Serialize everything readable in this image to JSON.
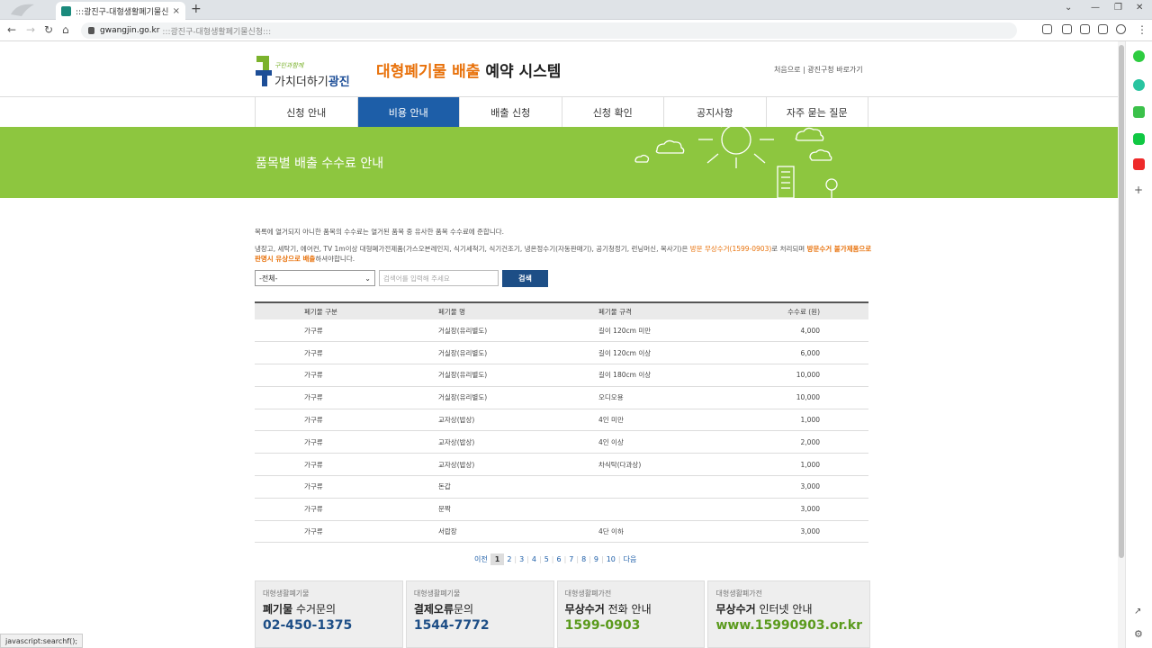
{
  "browser": {
    "tab_title": ":::광진구-대형생활폐기물신청:::",
    "close": "×",
    "new_tab": "+",
    "url_host": "gwangjin.go.kr",
    "url_path": ":::광진구-대형생활폐기물신청:::",
    "status_text": "javascript:searchf();"
  },
  "header": {
    "slogan": "구민과함께",
    "logo_text": "가치더하기",
    "logo_bold": "광진",
    "title_orange": "대형폐기물 배출",
    "title_rest": "예약 시스템",
    "links": "처음으로 | 광진구청 바로가기"
  },
  "nav": [
    {
      "label": "신청 안내",
      "active": false
    },
    {
      "label": "비용 안내",
      "active": true
    },
    {
      "label": "배출 신청",
      "active": false
    },
    {
      "label": "신청 확인",
      "active": false
    },
    {
      "label": "공지사항",
      "active": false
    },
    {
      "label": "자주 묻는 질문",
      "active": false
    }
  ],
  "banner": {
    "title": "품목별 배출 수수료 안내"
  },
  "notice": {
    "line1": "목록에 열거되지 아니한 품목의 수수료는 열거된 품목 중 유사한 품목 수수료에 준합니다.",
    "line2_a": "냉장고, 세탁기, 에어컨, TV 1m이상 대형폐가전제품(가스오븐레인지, 식기세척기, 식기건조기, 냉온정수기(자동판매기), 공기청정기, 런닝머신, 복사기)은",
    "line2_b": "방문 무상수거(1599-0903)",
    "line2_c": "로 처리되며",
    "line2_d": "방문수거 불가제품으로 판명시 유상으로 배출",
    "line2_e": "하셔야합니다."
  },
  "filter": {
    "select_value": "-전체-",
    "search_placeholder": "검색어를 입력해 주세요",
    "search_button": "검색"
  },
  "table": {
    "headers": [
      "폐기물 구분",
      "폐기물 명",
      "폐기물 규격",
      "수수료 (원)"
    ],
    "rows": [
      [
        "가구류",
        "거실장(유리별도)",
        "길이 120cm 미만",
        "4,000"
      ],
      [
        "가구류",
        "거실장(유리별도)",
        "길이 120cm 이상",
        "6,000"
      ],
      [
        "가구류",
        "거실장(유리별도)",
        "길이 180cm 이상",
        "10,000"
      ],
      [
        "가구류",
        "거실장(유리별도)",
        "오디오용",
        "10,000"
      ],
      [
        "가구류",
        "교자상(밥상)",
        "4인 미만",
        "1,000"
      ],
      [
        "가구류",
        "교자상(밥상)",
        "4인 이상",
        "2,000"
      ],
      [
        "가구류",
        "교자상(밥상)",
        "차식탁(다과상)",
        "1,000"
      ],
      [
        "가구류",
        "돈갑",
        "",
        "3,000"
      ],
      [
        "가구류",
        "문짝",
        "",
        "3,000"
      ],
      [
        "가구류",
        "서랍장",
        "4단 이하",
        "3,000"
      ]
    ]
  },
  "pager": {
    "prev": "이전",
    "pages": [
      "1",
      "2",
      "3",
      "4",
      "5",
      "6",
      "7",
      "8",
      "9",
      "10"
    ],
    "current": "1",
    "next": "다음"
  },
  "info": [
    {
      "sub": "대형생활폐기물",
      "main_bold": "폐기물",
      "main_rest": " 수거문의",
      "tel": "02-450-1375",
      "color": "blue"
    },
    {
      "sub": "대형생활폐기물",
      "main_bold": "결제오류",
      "main_rest": "문의",
      "tel": "1544-7772",
      "color": "blue"
    },
    {
      "sub": "대형생활폐가전",
      "main_bold": "무상수거",
      "main_rest": " 전화 안내",
      "tel": "1599-0903",
      "color": "green"
    },
    {
      "sub": "대형생활폐가전",
      "main_bold": "무상수거",
      "main_rest": " 인터넷 안내",
      "tel": "www.15990903.or.kr",
      "color": "green"
    }
  ]
}
